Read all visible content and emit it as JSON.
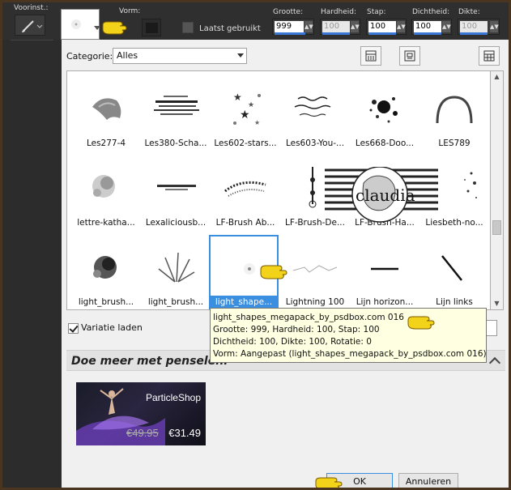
{
  "toolbar": {
    "preset_label": "Voorinst.:",
    "shape_label": "Vorm:",
    "last_used_label": "Laatst gebruikt",
    "size_label": "Grootte:",
    "hardness_label": "Hardheid:",
    "step_label": "Stap:",
    "density_label": "Dichtheid:",
    "thickness_label": "Dikte:",
    "size_value": "999",
    "hardness_value": "100",
    "step_value": "100",
    "density_value": "100",
    "thickness_value": "100"
  },
  "dialog": {
    "category_label": "Categorie:",
    "category_value": "Alles",
    "variation_label": "Variatie laden",
    "more_title": "Doe meer met penselen.",
    "ok_label": "OK",
    "cancel_label": "Annuleren"
  },
  "grid": {
    "items": [
      {
        "label": "Les277-4"
      },
      {
        "label": "Les380-Scha..."
      },
      {
        "label": "Les602-stars..."
      },
      {
        "label": "Les603-You-..."
      },
      {
        "label": "Les668-Doo..."
      },
      {
        "label": "LES789"
      },
      {
        "label": "lettre-katha..."
      },
      {
        "label": "Lexaliciousb..."
      },
      {
        "label": "LF-Brush Ab..."
      },
      {
        "label": "LF-Brush-De..."
      },
      {
        "label": "LF-Brush-Ha..."
      },
      {
        "label": "Liesbeth-no..."
      },
      {
        "label": "light_brush..."
      },
      {
        "label": "light_brush..."
      },
      {
        "label": "light_shape..."
      },
      {
        "label": "Lightning 100"
      },
      {
        "label": "Lijn horizon..."
      },
      {
        "label": "Lijn links"
      }
    ]
  },
  "tooltip": {
    "line1": "light_shapes_megapack_by_psdbox.com 016",
    "line2": "Grootte: 999, Hardheid: 100, Stap: 100",
    "line3": "Dichtheid: 100, Dikte: 100, Rotatie: 0",
    "line4": "Vorm: Aangepast (light_shapes_megapack_by_psdbox.com 016)"
  },
  "ad": {
    "title": "ParticleShop",
    "old_price": "€49.95",
    "new_price": "€31.49"
  },
  "watermark": "claudia",
  "colors": {
    "accent": "#3b8fe0",
    "tooltip_bg": "#ffffe1",
    "frame": "#4a3520"
  }
}
